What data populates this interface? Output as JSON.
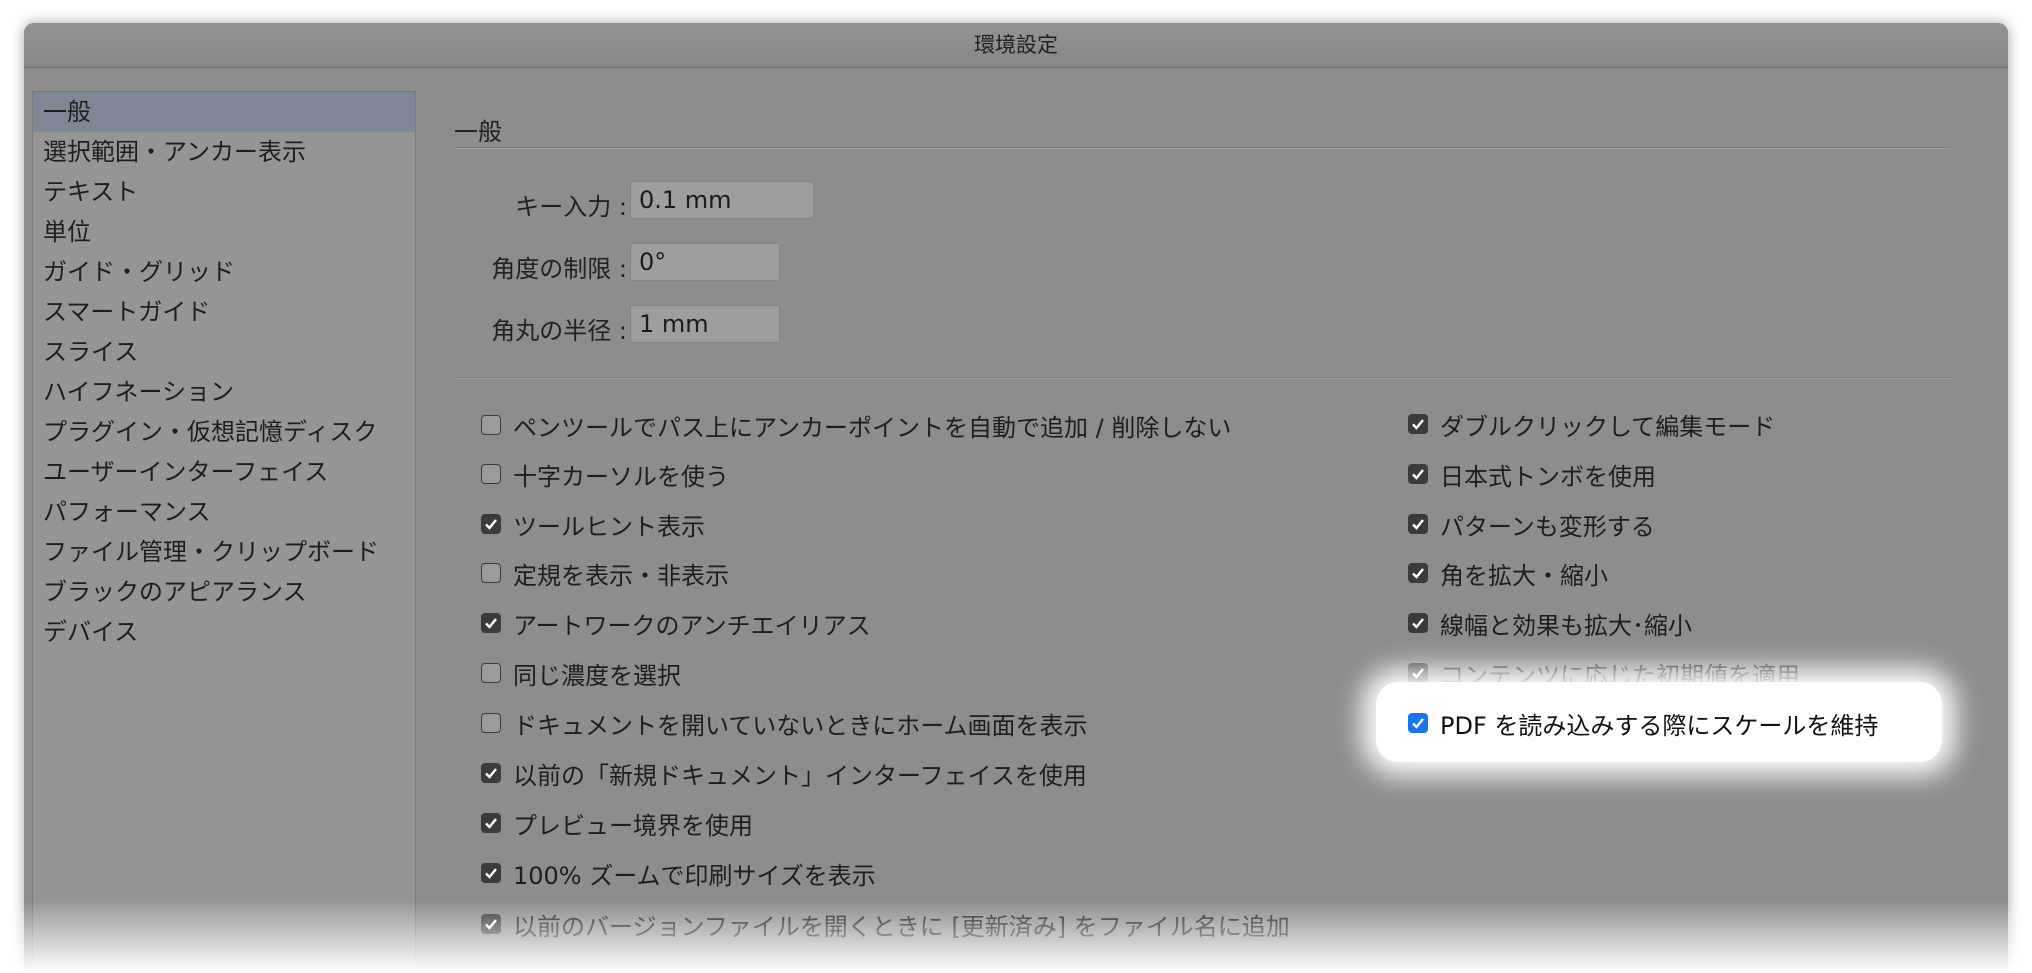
{
  "window": {
    "title": "環境設定"
  },
  "sidebar": {
    "items": [
      "一般",
      "選択範囲・アンカー表示",
      "テキスト",
      "単位",
      "ガイド・グリッド",
      "スマートガイド",
      "スライス",
      "ハイフネーション",
      "プラグイン・仮想記憶ディスク",
      "ユーザーインターフェイス",
      "パフォーマンス",
      "ファイル管理・クリップボード",
      "ブラックのアピアランス",
      "デバイス"
    ],
    "selected_index": 0
  },
  "main": {
    "section_title": "一般",
    "fields": [
      {
        "label": "キー入力 :",
        "value": "0.1 mm"
      },
      {
        "label": "角度の制限 :",
        "value": "0°"
      },
      {
        "label": "角丸の半径 :",
        "value": "1 mm"
      }
    ],
    "options_left": [
      {
        "label": "ペンツールでパス上にアンカーポイントを自動で追加 / 削除しない",
        "checked": false
      },
      {
        "label": "十字カーソルを使う",
        "checked": false
      },
      {
        "label": "ツールヒント表示",
        "checked": true
      },
      {
        "label": "定規を表示・非表示",
        "checked": false
      },
      {
        "label": "アートワークのアンチエイリアス",
        "checked": true
      },
      {
        "label": "同じ濃度を選択",
        "checked": false
      },
      {
        "label": "ドキュメントを開いていないときにホーム画面を表示",
        "checked": false
      },
      {
        "label": "以前の「新規ドキュメント」インターフェイスを使用",
        "checked": true
      },
      {
        "label": "プレビュー境界を使用",
        "checked": true
      },
      {
        "label": "100% ズームで印刷サイズを表示",
        "checked": true
      },
      {
        "label": "以前のバージョンファイルを開くときに [更新済み] をファイル名に追加",
        "checked": true
      }
    ],
    "options_right": [
      {
        "label": "ダブルクリックして編集モード",
        "checked": true
      },
      {
        "label": "日本式トンボを使用",
        "checked": true
      },
      {
        "label": "パターンも変形する",
        "checked": true
      },
      {
        "label": "角を拡大・縮小",
        "checked": true
      },
      {
        "label": "線幅と効果も拡大･縮小",
        "checked": true
      },
      {
        "label": "コンテンツに応じた初期値を適用",
        "checked": true
      },
      {
        "label": "PDF を読み込みする際にスケールを維持",
        "checked": true,
        "highlighted": true
      }
    ]
  },
  "colors": {
    "accent": "#1876f2",
    "window_bg": "#8d8d8d"
  }
}
